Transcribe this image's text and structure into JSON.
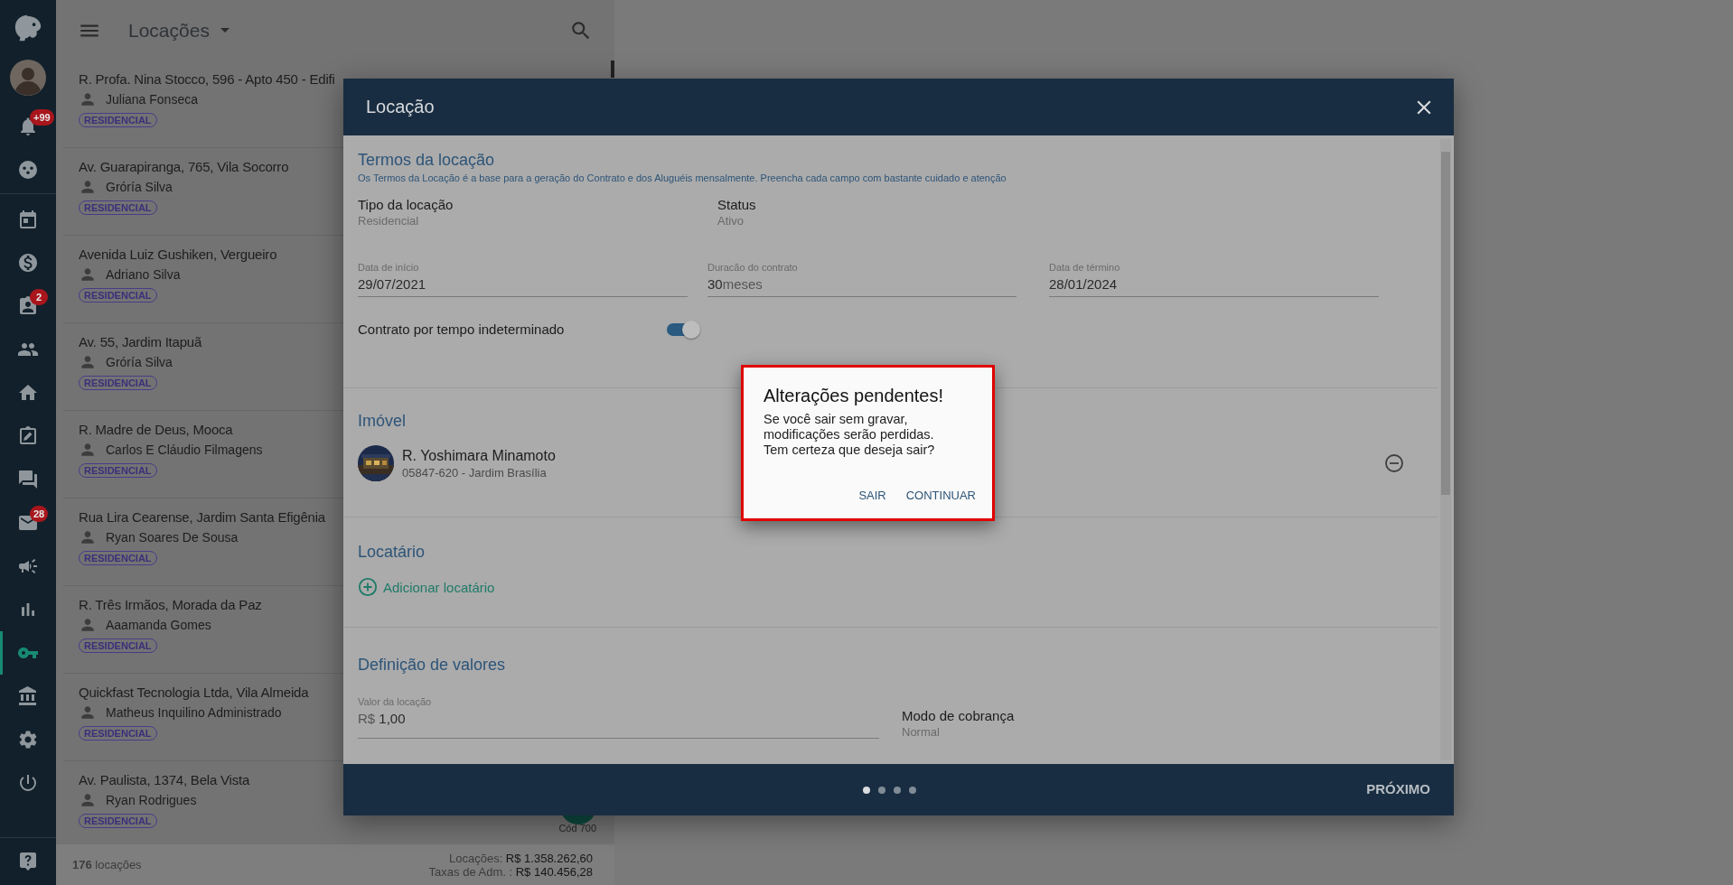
{
  "sidebar": {
    "nav_items": [
      {
        "selected": false,
        "badge": "+99"
      },
      {
        "selected": false
      },
      {
        "selected": false
      },
      {
        "selected": false
      },
      {
        "selected": false,
        "badge": "2"
      },
      {
        "selected": false
      },
      {
        "selected": false
      },
      {
        "selected": false
      },
      {
        "selected": false
      },
      {
        "selected": false,
        "badge": "28"
      },
      {
        "selected": false
      },
      {
        "selected": false
      },
      {
        "selected": true
      },
      {
        "selected": false
      },
      {
        "selected": false
      },
      {
        "selected": false
      }
    ]
  },
  "list": {
    "title": "Locações",
    "items": [
      {
        "address": "R. Profa. Nina Stocco, 596 - Apto 450 - Edifi",
        "tenant": "Juliana Fonseca",
        "tag": "RESIDENCIAL"
      },
      {
        "address": "Av. Guarapiranga, 765, Vila Socorro",
        "tenant": "Gróría Silva",
        "tag": "RESIDENCIAL"
      },
      {
        "address": "Avenida Luiz Gushiken, Vergueiro",
        "tenant": "Adriano Silva",
        "tag": "RESIDENCIAL"
      },
      {
        "address": "Av. 55, Jardim Itapuã",
        "tenant": "Gróría Silva",
        "tag": "RESIDENCIAL"
      },
      {
        "address": "R. Madre de Deus, Mooca",
        "tenant": "Carlos E Cláudio Filmagens",
        "tag": "RESIDENCIAL"
      },
      {
        "address": "Rua Lira Cearense, Jardim Santa Efigênia",
        "tenant": "Ryan Soares De Sousa",
        "tag": "RESIDENCIAL"
      },
      {
        "address": "R. Três Irmãos, Morada da Paz",
        "tenant": "Aaamanda Gomes",
        "tag": "RESIDENCIAL"
      },
      {
        "address": "Quickfast Tecnologia Ltda, Vila Almeida",
        "tenant": "Matheus Inquilino Administrado",
        "tag": "RESIDENCIAL"
      },
      {
        "address": "Av. Paulista, 1374, Bela Vista",
        "tenant": "Ryan Rodrigues",
        "tag": "RESIDENCIAL",
        "code": "Cód 700"
      }
    ],
    "summary": {
      "count": "176",
      "count_label": "locações",
      "totals": [
        {
          "label": "Locações:",
          "value": "R$ 1.358.262,60"
        },
        {
          "label": "Taxas de Adm. :",
          "value": "R$ 140.456,28"
        }
      ]
    }
  },
  "modal": {
    "title": "Locação",
    "terms": {
      "title": "Termos da locação",
      "subtitle": "Os Termos da Locação é a base para a geração do Contrato e dos Aluguéis mensalmente. Preencha cada campo com bastante cuidado e atenção",
      "info": [
        {
          "label": "Tipo da locação",
          "value": "Residencial"
        },
        {
          "label": "Status",
          "value": "Ativo"
        }
      ],
      "fields": [
        {
          "label": "Data de início",
          "value": "29/07/2021"
        },
        {
          "label": "Duracão do contrato",
          "value": "30",
          "suffix": "meses"
        },
        {
          "label": "Data de término",
          "value": "28/01/2024"
        }
      ],
      "toggle": {
        "label": "Contrato por tempo indeterminado",
        "on": true
      }
    },
    "property": {
      "title": "Imóvel",
      "name": "R. Yoshimara Minamoto",
      "address": "05847-620 - Jardim Brasília"
    },
    "tenant": {
      "title": "Locatário",
      "action": "Adicionar locatário"
    },
    "values": {
      "title": "Definição de valores",
      "field": {
        "label": "Valor da locação",
        "prefix": "R$",
        "value": "1,00"
      },
      "info": {
        "label": "Modo de cobrança",
        "value": "Normal"
      }
    },
    "steps": [
      {
        "selected": true
      },
      {
        "selected": false
      },
      {
        "selected": false
      },
      {
        "selected": false
      }
    ],
    "next": "PRÓXIMO"
  },
  "dialog": {
    "title": "Alterações pendentes!",
    "message": "Se você sair sem gravar, modificações serão perdidas. Tem certeza que deseja sair?",
    "buttons": [
      "SAIR",
      "CONTINUAR"
    ]
  }
}
